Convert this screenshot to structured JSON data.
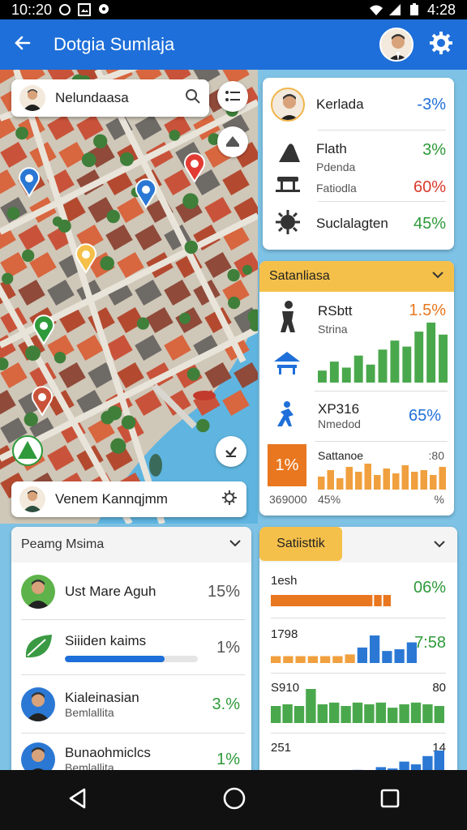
{
  "status": {
    "time": "10::20",
    "battery_time": "4:28"
  },
  "app": {
    "title": "Dotgia Sumlaja"
  },
  "map": {
    "search_label": "Nelundaasa",
    "bottom_label": "Venem Kannqjmm"
  },
  "card1": {
    "rows": [
      {
        "title": "Kerlada",
        "sub": "",
        "pct": "-3%"
      },
      {
        "title": "Flath",
        "sub": "Pdenda",
        "pct": "3%"
      },
      {
        "title": "",
        "sub": "Fatiodla",
        "pct": "60%"
      },
      {
        "title": "Suclalagten",
        "sub": "",
        "pct": "45%"
      }
    ]
  },
  "card2": {
    "header": "Satanliasa",
    "rows": [
      {
        "title": "RSbtt",
        "sub": "Strina",
        "pct": "1.5%"
      },
      {
        "title": "XP316",
        "sub": "Nmedod",
        "pct": "65%"
      }
    ],
    "bottom": {
      "badge": "1%",
      "label": "Sattanoe",
      "value": ":80",
      "left": "369000",
      "mid": "45%",
      "right": "%"
    },
    "chart1_values": [
      20,
      35,
      25,
      45,
      30,
      55,
      70,
      60,
      85,
      100,
      80
    ],
    "chart2_values": [
      40,
      60,
      35,
      70,
      55,
      80,
      45,
      65,
      50,
      75,
      55,
      60,
      45,
      70
    ]
  },
  "list": {
    "header": "Peamg Msima",
    "items": [
      {
        "name": "Ust Mare Aguh",
        "sub": "",
        "pct": "15%"
      },
      {
        "name": "Siiiden kaims",
        "sub": "",
        "pct": "1%"
      },
      {
        "name": "Kialeinasian",
        "sub": "Bemlallita",
        "pct": "3.%"
      },
      {
        "name": "Bunaohmiclcs",
        "sub": "Bemlallita",
        "pct": "1%"
      }
    ],
    "progress": 0.75
  },
  "stats": {
    "tab": "Satiisttik",
    "rows": [
      {
        "label": "1esh",
        "value": "06%"
      },
      {
        "label": "1798",
        "value": "7:58"
      },
      {
        "label": "S910",
        "value": "80"
      },
      {
        "label": "251",
        "value": "14"
      }
    ],
    "chartA": [
      90,
      8,
      8
    ],
    "chartB": [
      20,
      20,
      20,
      20,
      20,
      20,
      25,
      45,
      80,
      35,
      40,
      60
    ],
    "chartC": [
      50,
      55,
      50,
      100,
      55,
      60,
      50,
      60,
      55,
      60,
      45,
      55,
      60,
      55,
      50
    ],
    "chartD": [
      10,
      15,
      10,
      20,
      15,
      25,
      20,
      30,
      25,
      40,
      35,
      60,
      50,
      80,
      100
    ]
  },
  "colors": {
    "app_bar": "#1e6fd9",
    "accent": "#f5c04a",
    "green": "#2e9a3a",
    "red": "#d93a2b"
  }
}
